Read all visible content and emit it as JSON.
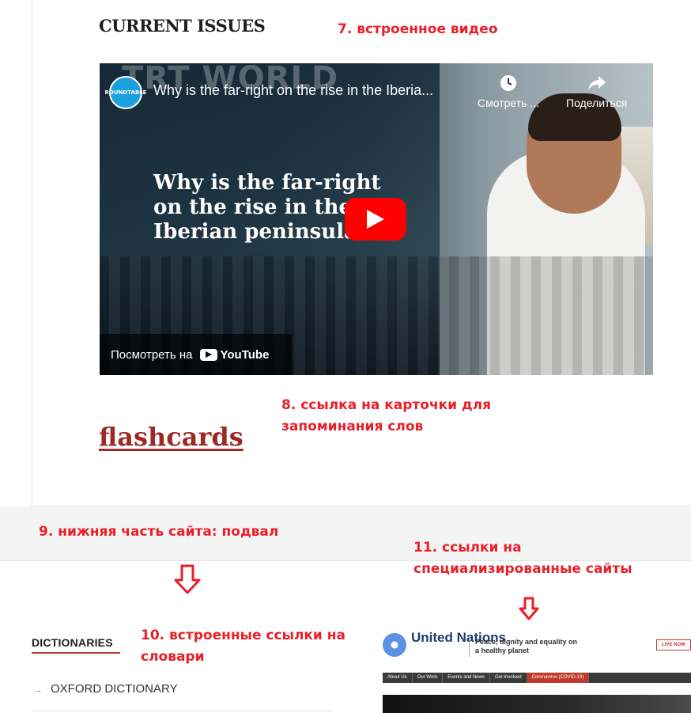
{
  "main": {
    "section_title": "CURRENT ISSUES",
    "video": {
      "brand_watermark": "TRT WORLD",
      "channel_avatar_text": "ROUNDTABLE",
      "title": "Why is the far-right on the rise in the Iberia...",
      "watch_later_label": "Смотреть ...",
      "share_label": "Поделиться",
      "headline": "Why is the far-right on the rise in the Iberian peninsula?",
      "watch_on_label": "Посмотреть на",
      "youtube_label": "YouTube"
    },
    "flashcards_link": "flashcards"
  },
  "annotations": {
    "a7": "7. встроенное видео",
    "a8": "8. ссылка на карточки для запоминания слов",
    "a9": "9. нижняя часть сайта: подвал",
    "a10": "10. встроенные ссылки на словари",
    "a11": "11. ссылки на специализированные сайты"
  },
  "footer": {
    "dictionaries_heading": "DICTIONARIES",
    "dictionary_items": [
      "OXFORD DICTIONARY"
    ],
    "un_site": {
      "name": "United Nations",
      "tagline": "Peace, dignity and equality on a healthy planet",
      "live_label": "LIVE NOW",
      "nav": [
        "About Us",
        "Our Work",
        "Events and News",
        "Get Involved",
        "Coronavirus (COVID-19)"
      ]
    }
  },
  "colors": {
    "annotation": "#e8202a",
    "flashcards_link": "#9c2a27",
    "accent_underline": "#c0392b",
    "youtube_red": "#ff0000"
  },
  "icons": [
    "clock-icon",
    "share-icon",
    "play-icon",
    "youtube-logo-icon",
    "arrow-right-icon",
    "down-arrow-icon",
    "un-emblem-icon"
  ]
}
